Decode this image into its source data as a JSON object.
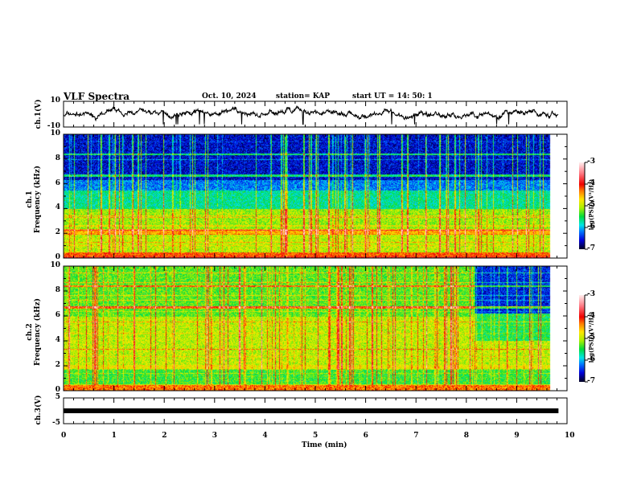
{
  "header": {
    "title": "VLF Spectra",
    "date": "Oct. 10, 2024",
    "station": "station= KAP",
    "start": "start  UT =   14: 50: 1"
  },
  "chart_data": [
    {
      "type": "line",
      "ylabel": "ch.1(V)",
      "ylim": [
        -10,
        10
      ],
      "yticks": [
        "10",
        "-10"
      ],
      "xlim": [
        0,
        10
      ]
    },
    {
      "type": "heatmap",
      "ylabel": "ch.1\nFrequency (kHz)",
      "ylabel_1": "ch.1",
      "ylabel_2": "Frequency (kHz)",
      "ylim": [
        0,
        10
      ],
      "yticks": [
        "0",
        "2",
        "4",
        "6",
        "8",
        "10"
      ],
      "xlim": [
        0,
        10
      ],
      "data_end_min": 9.83,
      "colorbar": {
        "label": "log(PSD)(V²/Hz)",
        "range": [
          -7,
          -3
        ],
        "ticks": [
          "-3",
          "-4",
          "-5",
          "-6",
          "-7"
        ]
      }
    },
    {
      "type": "heatmap",
      "ylabel_1": "ch.2",
      "ylabel_2": "Frequency (kHz)",
      "ylim": [
        0,
        10
      ],
      "yticks": [
        "0",
        "2",
        "4",
        "6",
        "8",
        "10"
      ],
      "xlim": [
        0,
        10
      ],
      "data_end_min": 9.83,
      "colorbar": {
        "label": "log(PSD)(V²/Hz)",
        "range": [
          -7,
          -3
        ],
        "ticks": [
          "-3",
          "-4",
          "-5",
          "-6",
          "-7"
        ]
      }
    },
    {
      "type": "line",
      "ylabel": "ch.3(V)",
      "ylim": [
        -5,
        5
      ],
      "yticks": [
        "5",
        "-5"
      ],
      "xlim": [
        0,
        10
      ]
    }
  ],
  "xaxis": {
    "label": "Time  (min)",
    "ticks": [
      "0",
      "1",
      "2",
      "3",
      "4",
      "5",
      "6",
      "7",
      "8",
      "9",
      "10"
    ]
  }
}
